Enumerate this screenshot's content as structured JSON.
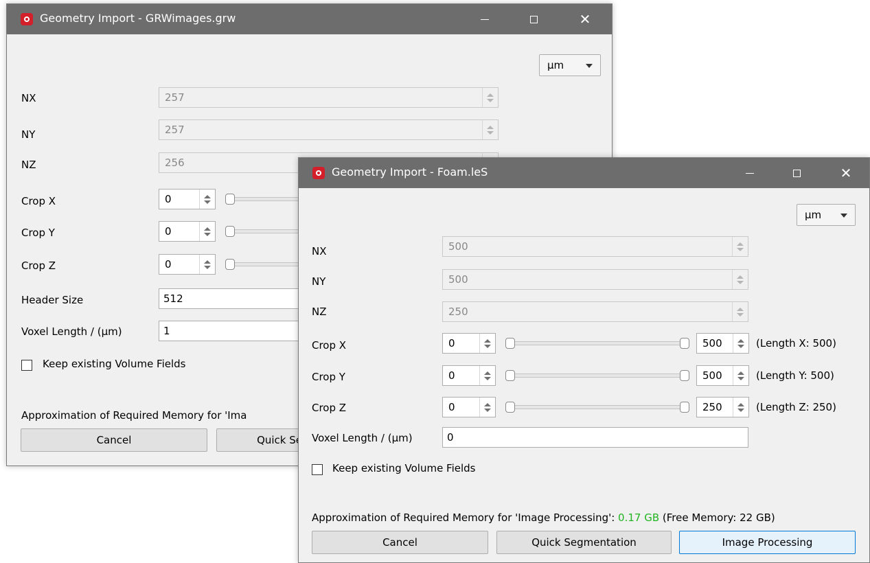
{
  "back_window": {
    "title": "Geometry Import - GRWimages.grw",
    "unit_select": "µm",
    "fields": {
      "nx": {
        "label": "NX",
        "value": "257"
      },
      "ny": {
        "label": "NY",
        "value": "257"
      },
      "nz": {
        "label": "NZ",
        "value": "256"
      },
      "crop_x": {
        "label": "Crop X",
        "min": "0"
      },
      "crop_y": {
        "label": "Crop Y",
        "min": "0"
      },
      "crop_z": {
        "label": "Crop Z",
        "min": "0"
      },
      "header_size": {
        "label": "Header Size",
        "value": "512"
      },
      "voxel_length": {
        "label": "Voxel Length / (µm)",
        "value": "1"
      }
    },
    "keep_fields_label": "Keep existing Volume Fields",
    "memory_text": "Approximation of Required Memory for 'Ima",
    "buttons": {
      "cancel": "Cancel",
      "quick_segmentation": "Quick Se"
    }
  },
  "front_window": {
    "title": "Geometry Import - Foam.leS",
    "unit_select": "µm",
    "fields": {
      "nx": {
        "label": "NX",
        "value": "500"
      },
      "ny": {
        "label": "NY",
        "value": "500"
      },
      "nz": {
        "label": "NZ",
        "value": "250"
      },
      "crop_x": {
        "label": "Crop X",
        "min": "0",
        "max": "500",
        "length_text": "(Length X: 500)"
      },
      "crop_y": {
        "label": "Crop Y",
        "min": "0",
        "max": "500",
        "length_text": "(Length Y: 500)"
      },
      "crop_z": {
        "label": "Crop Z",
        "min": "0",
        "max": "250",
        "length_text": "(Length Z: 250)"
      },
      "voxel_length": {
        "label": "Voxel Length / (µm)",
        "value": "0"
      }
    },
    "keep_fields_label": "Keep existing Volume Fields",
    "memory": {
      "prefix": "Approximation of Required Memory for 'Image Processing': ",
      "value": "0.17 GB",
      "suffix": " (Free Memory: 22 GB)",
      "value_color": "#22b422"
    },
    "buttons": {
      "cancel": "Cancel",
      "quick_segmentation": "Quick Segmentation",
      "image_processing": "Image Processing"
    }
  },
  "colors": {
    "titlebar": "#6d6d6d",
    "app_icon": "#d21f2a",
    "primary_button_border": "#0078d7"
  }
}
